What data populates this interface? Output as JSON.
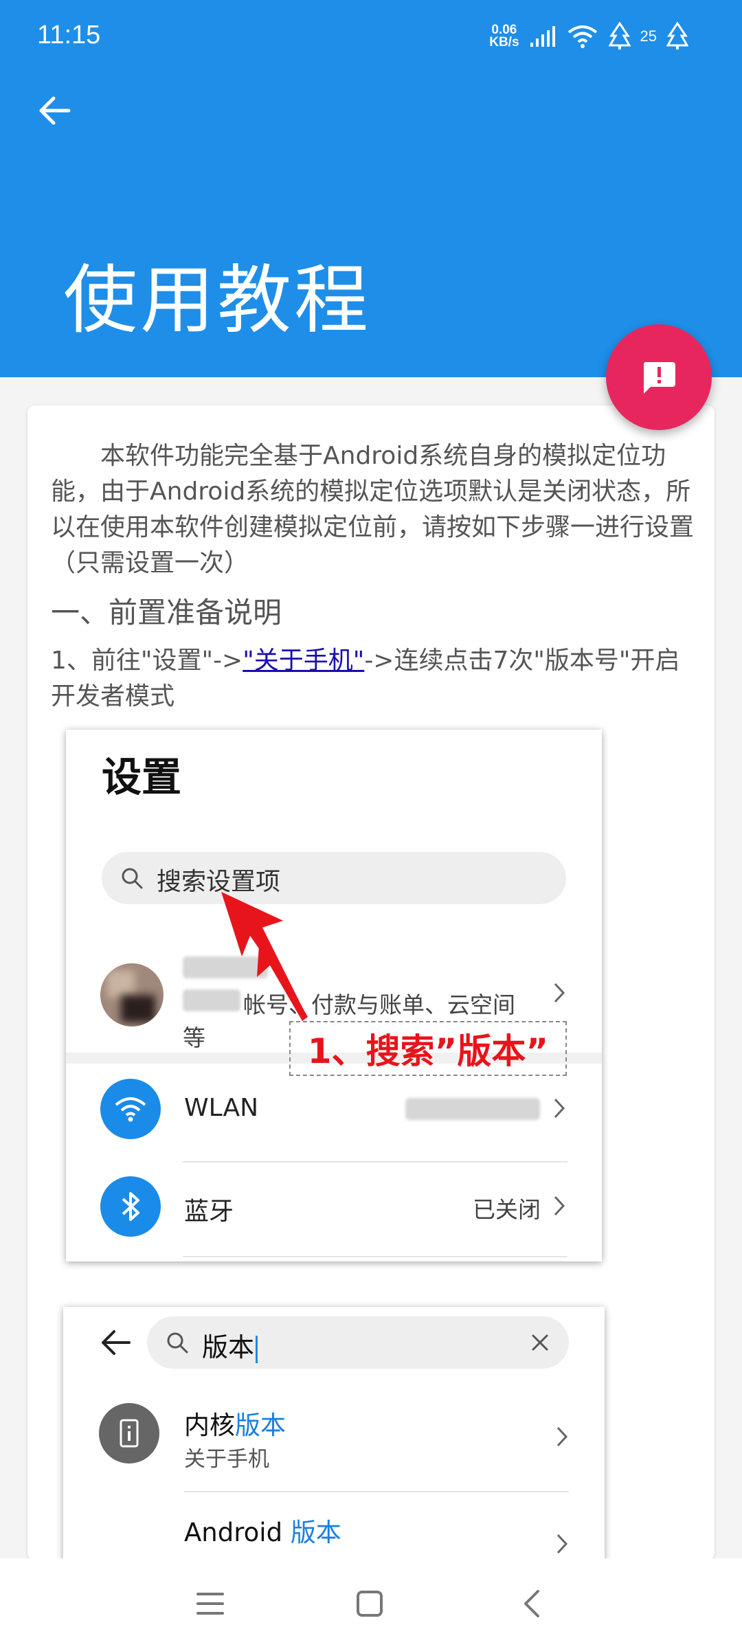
{
  "status_bar": {
    "time": "11:15",
    "net_speed_value": "0.06",
    "net_speed_unit": "KB/s",
    "badge_count": "25"
  },
  "header": {
    "title": "使用教程"
  },
  "content": {
    "intro": "本软件功能完全基于Android系统自身的模拟定位功能，由于Android系统的模拟定位选项默认是关闭状态，所以在使用本软件创建模拟定位前，请按如下步骤一进行设置（只需设置一次）",
    "section_title": "一、前置准备说明",
    "step1": {
      "prefix": "1、前往\"设置\"->",
      "link": "\"关于手机\"",
      "suffix": "->连续点击7次\"版本号\"开启开发者模式"
    }
  },
  "screenshot1": {
    "title": "设置",
    "search_placeholder": "搜索设置项",
    "account_sub_line1": "帐号、付款与账单、云空间",
    "account_sub_line2": "等",
    "wlan_label": "WLAN",
    "bluetooth_label": "蓝牙",
    "bluetooth_value": "已关闭",
    "annotation": "1、搜索”版本”"
  },
  "screenshot2": {
    "search_text": "版本",
    "item1_title_prefix": "内核",
    "item1_title_highlight": "版本",
    "item1_sub": "关于手机",
    "item2_title_prefix": "Android ",
    "item2_title_highlight": "版本"
  },
  "colors": {
    "app_bar": "#1e8ee8",
    "fab": "#e8265e",
    "annotation": "#e8141b",
    "link": "#1a0dab"
  }
}
